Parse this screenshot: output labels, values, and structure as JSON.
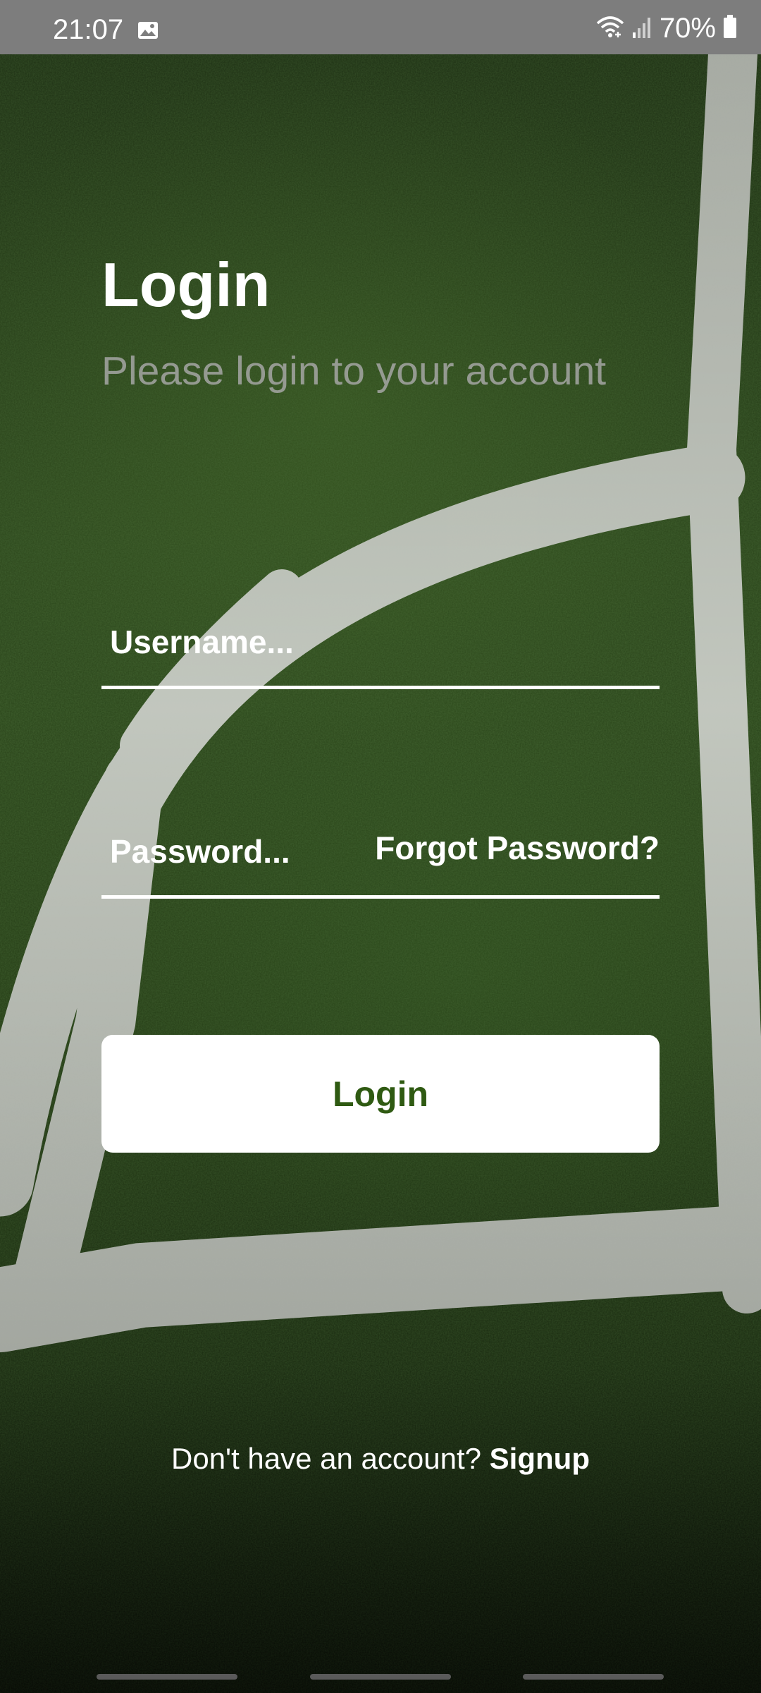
{
  "status_bar": {
    "time": "21:07",
    "battery": "70%",
    "icons": [
      "image-icon",
      "wifi-icon",
      "signal-icon",
      "battery-icon"
    ]
  },
  "login": {
    "title": "Login",
    "subtitle": "Please login to your account",
    "username_placeholder": "Username...",
    "password_placeholder": "Password...",
    "forgot_password": "Forgot Password?",
    "button_label": "Login",
    "signup_prompt": "Don't have an account?",
    "signup_link": "Signup"
  },
  "colors": {
    "button_text": "#2f5a12",
    "status_bar": "#7d7d7d",
    "text": "#ffffff"
  }
}
